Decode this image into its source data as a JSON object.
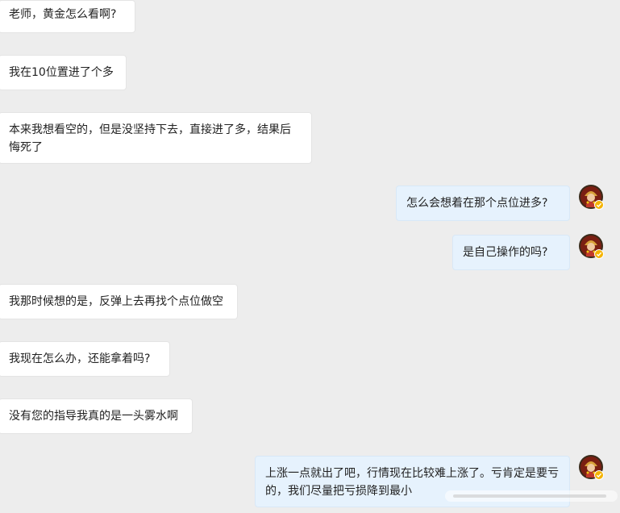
{
  "conversation": {
    "messages": [
      {
        "side": "left",
        "text": "老师，黄金怎么看啊?"
      },
      {
        "side": "left",
        "text": "我在10位置进了个多"
      },
      {
        "side": "left",
        "text": "本来我想看空的，但是没坚持下去，直接进了多，结果后悔死了"
      },
      {
        "side": "right",
        "text": "怎么会想着在那个点位进多?"
      },
      {
        "side": "right",
        "text": "是自己操作的吗?"
      },
      {
        "side": "left",
        "text": "我那时候想的是，反弹上去再找个点位做空"
      },
      {
        "side": "left",
        "text": "我现在怎么办，还能拿着吗?"
      },
      {
        "side": "left",
        "text": "没有您的指导我真的是一头雾水啊"
      },
      {
        "side": "right",
        "text": "上涨一点就出了吧，行情现在比较难上涨了。亏肯定是要亏的，我们尽量把亏损降到最小"
      }
    ]
  },
  "avatar": {
    "icon": "fortune-god-avatar-icon",
    "badge_icon": "verified-badge-icon",
    "badge_color": "#f5b400"
  },
  "colors": {
    "background": "#ededed",
    "left_bubble": "#ffffff",
    "right_bubble": "#e6f2fd",
    "text": "#222222"
  }
}
